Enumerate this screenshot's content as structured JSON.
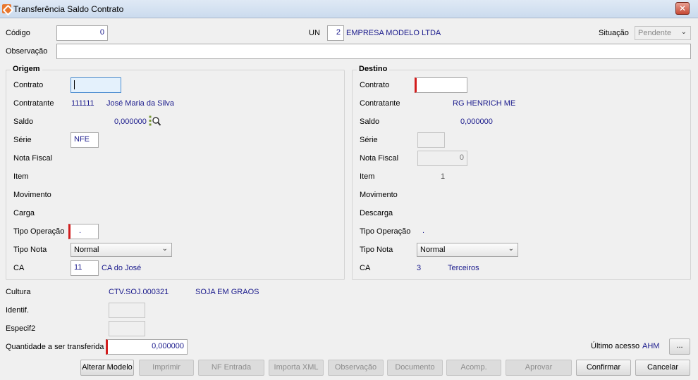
{
  "window": {
    "title": "Transferência Saldo Contrato",
    "close_glyph": "✕"
  },
  "header": {
    "codigo_label": "Código",
    "codigo_value": "0",
    "un_label": "UN",
    "un_value": "2",
    "empresa": "EMPRESA MODELO LTDA",
    "situacao_label": "Situação",
    "situacao_value": "Pendente",
    "observacao_label": "Observação",
    "observacao_value": ""
  },
  "origem": {
    "title": "Origem",
    "contrato_label": "Contrato",
    "contrato_value": "",
    "contratante_label": "Contratante",
    "contratante_code": "111111",
    "contratante_name": "José Maria da Silva",
    "saldo_label": "Saldo",
    "saldo_value": "0,000000",
    "serie_label": "Série",
    "serie_value": "NFE",
    "nota_fiscal_label": "Nota Fiscal",
    "item_label": "Item",
    "movimento_label": "Movimento",
    "carga_label": "Carga",
    "tipo_operacao_label": "Tipo Operação",
    "tipo_operacao_value": ".",
    "tipo_nota_label": "Tipo Nota",
    "tipo_nota_value": "Normal",
    "ca_label": "CA",
    "ca_value": "11",
    "ca_name": "CA do José"
  },
  "destino": {
    "title": "Destino",
    "contrato_label": "Contrato",
    "contrato_value": "",
    "contratante_label": "Contratante",
    "contratante_name": "RG HENRICH ME",
    "saldo_label": "Saldo",
    "saldo_value": "0,000000",
    "serie_label": "Série",
    "serie_value": "",
    "nota_fiscal_label": "Nota Fiscal",
    "nota_fiscal_value": "0",
    "item_label": "Item",
    "item_value": "1",
    "movimento_label": "Movimento",
    "descarga_label": "Descarga",
    "tipo_operacao_label": "Tipo Operação",
    "tipo_operacao_value": ".",
    "tipo_nota_label": "Tipo Nota",
    "tipo_nota_value": "Normal",
    "ca_label": "CA",
    "ca_value": "3",
    "ca_name": "Terceiros"
  },
  "footer": {
    "cultura_label": "Cultura",
    "cultura_code": "CTV.SOJ.000321",
    "cultura_name": "SOJA EM GRAOS",
    "identif_label": "Identif.",
    "especif_label": "Especif2",
    "quantidade_label": "Quantidade a ser transferida",
    "quantidade_value": "0,000000",
    "ultimo_acesso_label": "Último acesso",
    "ultimo_acesso_value": "AHM",
    "ellipsis_label": "..."
  },
  "buttons": {
    "alterar_modelo": "Alterar Modelo",
    "imprimir": "Imprimir",
    "nf_entrada": "NF Entrada",
    "importa_xml": "Importa XML",
    "observacao": "Observação",
    "documento": "Documento",
    "acomp": "Acomp.",
    "aprovar": "Aprovar",
    "confirmar": "Confirmar",
    "cancelar": "Cancelar"
  },
  "colors": {
    "value_text": "#1a1a8c",
    "required_marker": "#d21d1d",
    "title_bar": "#cbdbee"
  },
  "icons": {
    "app": "app-logo-icon",
    "close": "close-icon",
    "saldo_lookup": "magnifier-icon",
    "dropdown": "chevron-down-icon"
  }
}
